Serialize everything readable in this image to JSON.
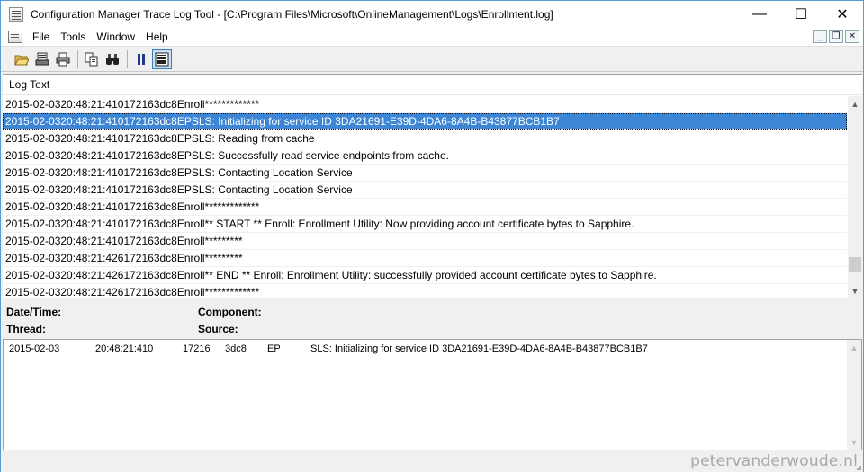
{
  "window": {
    "title": "Configuration Manager Trace Log Tool - [C:\\Program Files\\Microsoft\\OnlineManagement\\Logs\\Enrollment.log]",
    "minimize": "—",
    "maximize": "☐",
    "close": "✕"
  },
  "menu": {
    "items": [
      "File",
      "Tools",
      "Window",
      "Help"
    ],
    "mdi_minimize": "_",
    "mdi_restore": "❐",
    "mdi_close": "✕"
  },
  "toolbar": {
    "buttons": [
      "open-icon",
      "print-preview-icon",
      "print-icon",
      "copy-icon",
      "find-icon",
      "pause-icon",
      "details-pane-icon"
    ],
    "active": "details-pane-icon"
  },
  "log": {
    "header": "Log Text",
    "rows": [
      "2015-02-0320:48:21:410172163dc8Enroll*************",
      "2015-02-0320:48:21:410172163dc8EPSLS: Initializing for service ID 3DA21691-E39D-4DA6-8A4B-B43877BCB1B7",
      "2015-02-0320:48:21:410172163dc8EPSLS: Reading from cache",
      "2015-02-0320:48:21:410172163dc8EPSLS: Successfully read service endpoints from cache.",
      "2015-02-0320:48:21:410172163dc8EPSLS: Contacting Location Service",
      "2015-02-0320:48:21:410172163dc8EPSLS: Contacting Location Service",
      "2015-02-0320:48:21:410172163dc8Enroll*************",
      "2015-02-0320:48:21:410172163dc8Enroll** START **  Enroll: Enrollment Utility: Now providing account certificate bytes to Sapphire.",
      "2015-02-0320:48:21:410172163dc8Enroll*********",
      "2015-02-0320:48:21:426172163dc8Enroll*********",
      "2015-02-0320:48:21:426172163dc8Enroll**  END  **  Enroll: Enrollment Utility: successfully provided account certificate bytes to Sapphire.",
      "2015-02-0320:48:21:426172163dc8Enroll*************"
    ],
    "selected_index": 1,
    "scroll_position": 0.93
  },
  "details": {
    "date_label": "Date/Time:",
    "thread_label": "Thread:",
    "component_label": "Component:",
    "source_label": "Source:",
    "entry": {
      "date": "2015-02-03",
      "time": "20:48:21:410",
      "thread": "17216",
      "hex": "3dc8",
      "component": "EP",
      "message": "SLS: Initializing for service ID 3DA21691-E39D-4DA6-8A4B-B43877BCB1B7"
    }
  },
  "watermark": "petervanderwoude.nl",
  "colors": {
    "selection": "#3c86d5",
    "window_border": "#5a9bd5",
    "toolbar_active": "#c9e0f7"
  }
}
